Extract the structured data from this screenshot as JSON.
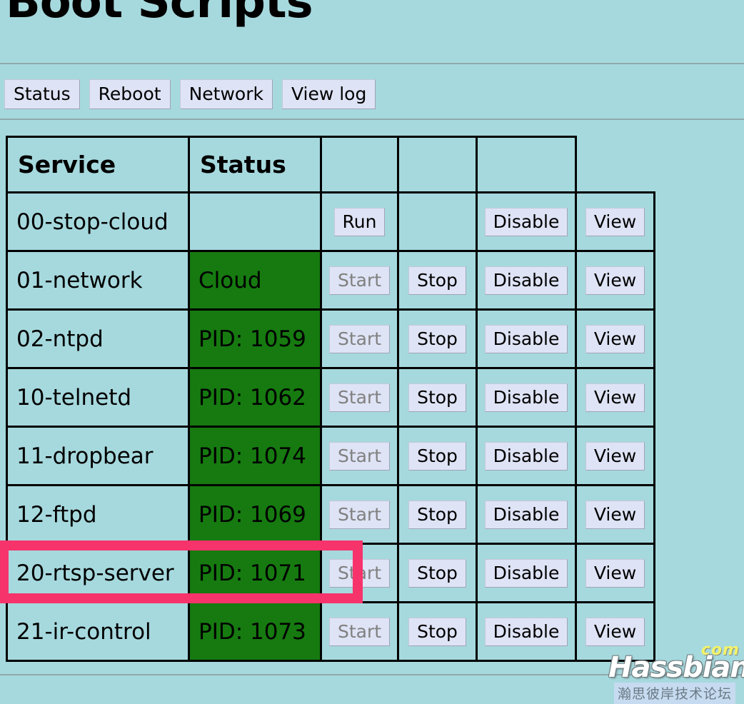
{
  "page": {
    "title": "Boot Scripts"
  },
  "nav": {
    "buttons": [
      {
        "label": "Status"
      },
      {
        "label": "Reboot"
      },
      {
        "label": "Network"
      },
      {
        "label": "View log"
      }
    ]
  },
  "table": {
    "headers": [
      "Service",
      "Status",
      "",
      "",
      ""
    ],
    "rows": [
      {
        "service": "00-stop-cloud",
        "status": "",
        "status_running": false,
        "actions": [
          "Run",
          "",
          "Disable",
          "View"
        ],
        "start_disabled": false,
        "highlighted": false
      },
      {
        "service": "01-network",
        "status": "Cloud",
        "status_running": true,
        "actions": [
          "Start",
          "Stop",
          "Disable",
          "View"
        ],
        "start_disabled": true,
        "highlighted": false
      },
      {
        "service": "02-ntpd",
        "status": "PID: 1059",
        "status_running": true,
        "actions": [
          "Start",
          "Stop",
          "Disable",
          "View"
        ],
        "start_disabled": true,
        "highlighted": false
      },
      {
        "service": "10-telnetd",
        "status": "PID: 1062",
        "status_running": true,
        "actions": [
          "Start",
          "Stop",
          "Disable",
          "View"
        ],
        "start_disabled": true,
        "highlighted": false
      },
      {
        "service": "11-dropbear",
        "status": "PID: 1074",
        "status_running": true,
        "actions": [
          "Start",
          "Stop",
          "Disable",
          "View"
        ],
        "start_disabled": true,
        "highlighted": false
      },
      {
        "service": "12-ftpd",
        "status": "PID: 1069",
        "status_running": true,
        "actions": [
          "Start",
          "Stop",
          "Disable",
          "View"
        ],
        "start_disabled": true,
        "highlighted": false
      },
      {
        "service": "20-rtsp-server",
        "status": "PID: 1071",
        "status_running": true,
        "actions": [
          "Start",
          "Stop",
          "Disable",
          "View"
        ],
        "start_disabled": true,
        "highlighted": true
      },
      {
        "service": "21-ir-control",
        "status": "PID: 1073",
        "status_running": true,
        "actions": [
          "Start",
          "Stop",
          "Disable",
          "View"
        ],
        "start_disabled": true,
        "highlighted": false
      }
    ]
  },
  "watermark": {
    "com": "com",
    "name": "Hassbian",
    "chinese": "瀚思彼岸技术论坛"
  },
  "colors": {
    "background": "#a6d9de",
    "running_green": "#167a10",
    "button_face": "#dee3f5",
    "highlight_pink": "#f7336b",
    "rule_gray": "#8fa9ab"
  }
}
